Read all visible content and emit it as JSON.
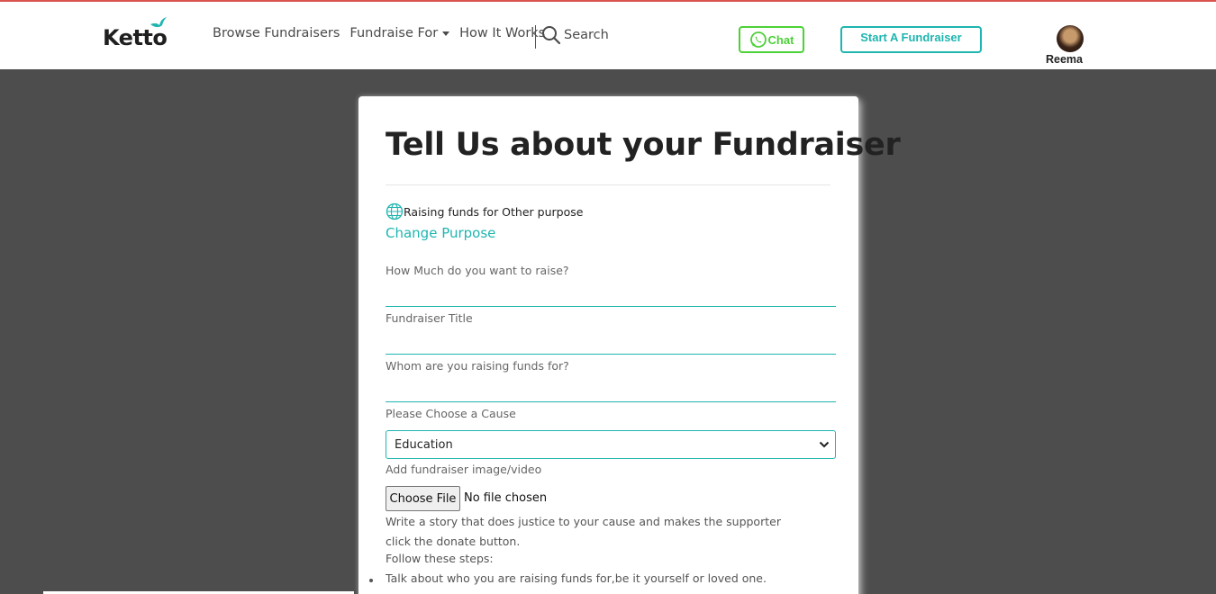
{
  "header": {
    "logo_text": "Ketto",
    "nav": {
      "browse": "Browse Fundraisers",
      "fundraise_for": "Fundraise For",
      "how_it_works": "How It Works",
      "search": "Search"
    },
    "chat_label": "Chat",
    "start_label": "Start A Fundraiser",
    "user_name": "Reema"
  },
  "form": {
    "title": "Tell Us about your Fundraiser",
    "purpose_text": "Raising funds for Other purpose",
    "change_purpose": "Change Purpose",
    "amount_label": "How Much do you want to raise?",
    "amount_value": "",
    "title_label": "Fundraiser Title",
    "title_value": "",
    "whom_label": "Whom are you raising funds for?",
    "whom_value": "",
    "cause_label": "Please Choose a Cause",
    "cause_selected": "Education",
    "media_label": "Add fundraiser image/video",
    "choose_file": "Choose File",
    "file_status": "No file chosen",
    "story_text": "Write a story that does justice to your cause and makes the supporter click the donate button.",
    "steps_label": "Follow these steps:",
    "steps": [
      "Talk about who you are raising funds for,be it yourself or loved one."
    ]
  },
  "colors": {
    "accent": "#1fb5b0",
    "chat_green": "#4cd137",
    "overlay": "#4d4d4d"
  }
}
